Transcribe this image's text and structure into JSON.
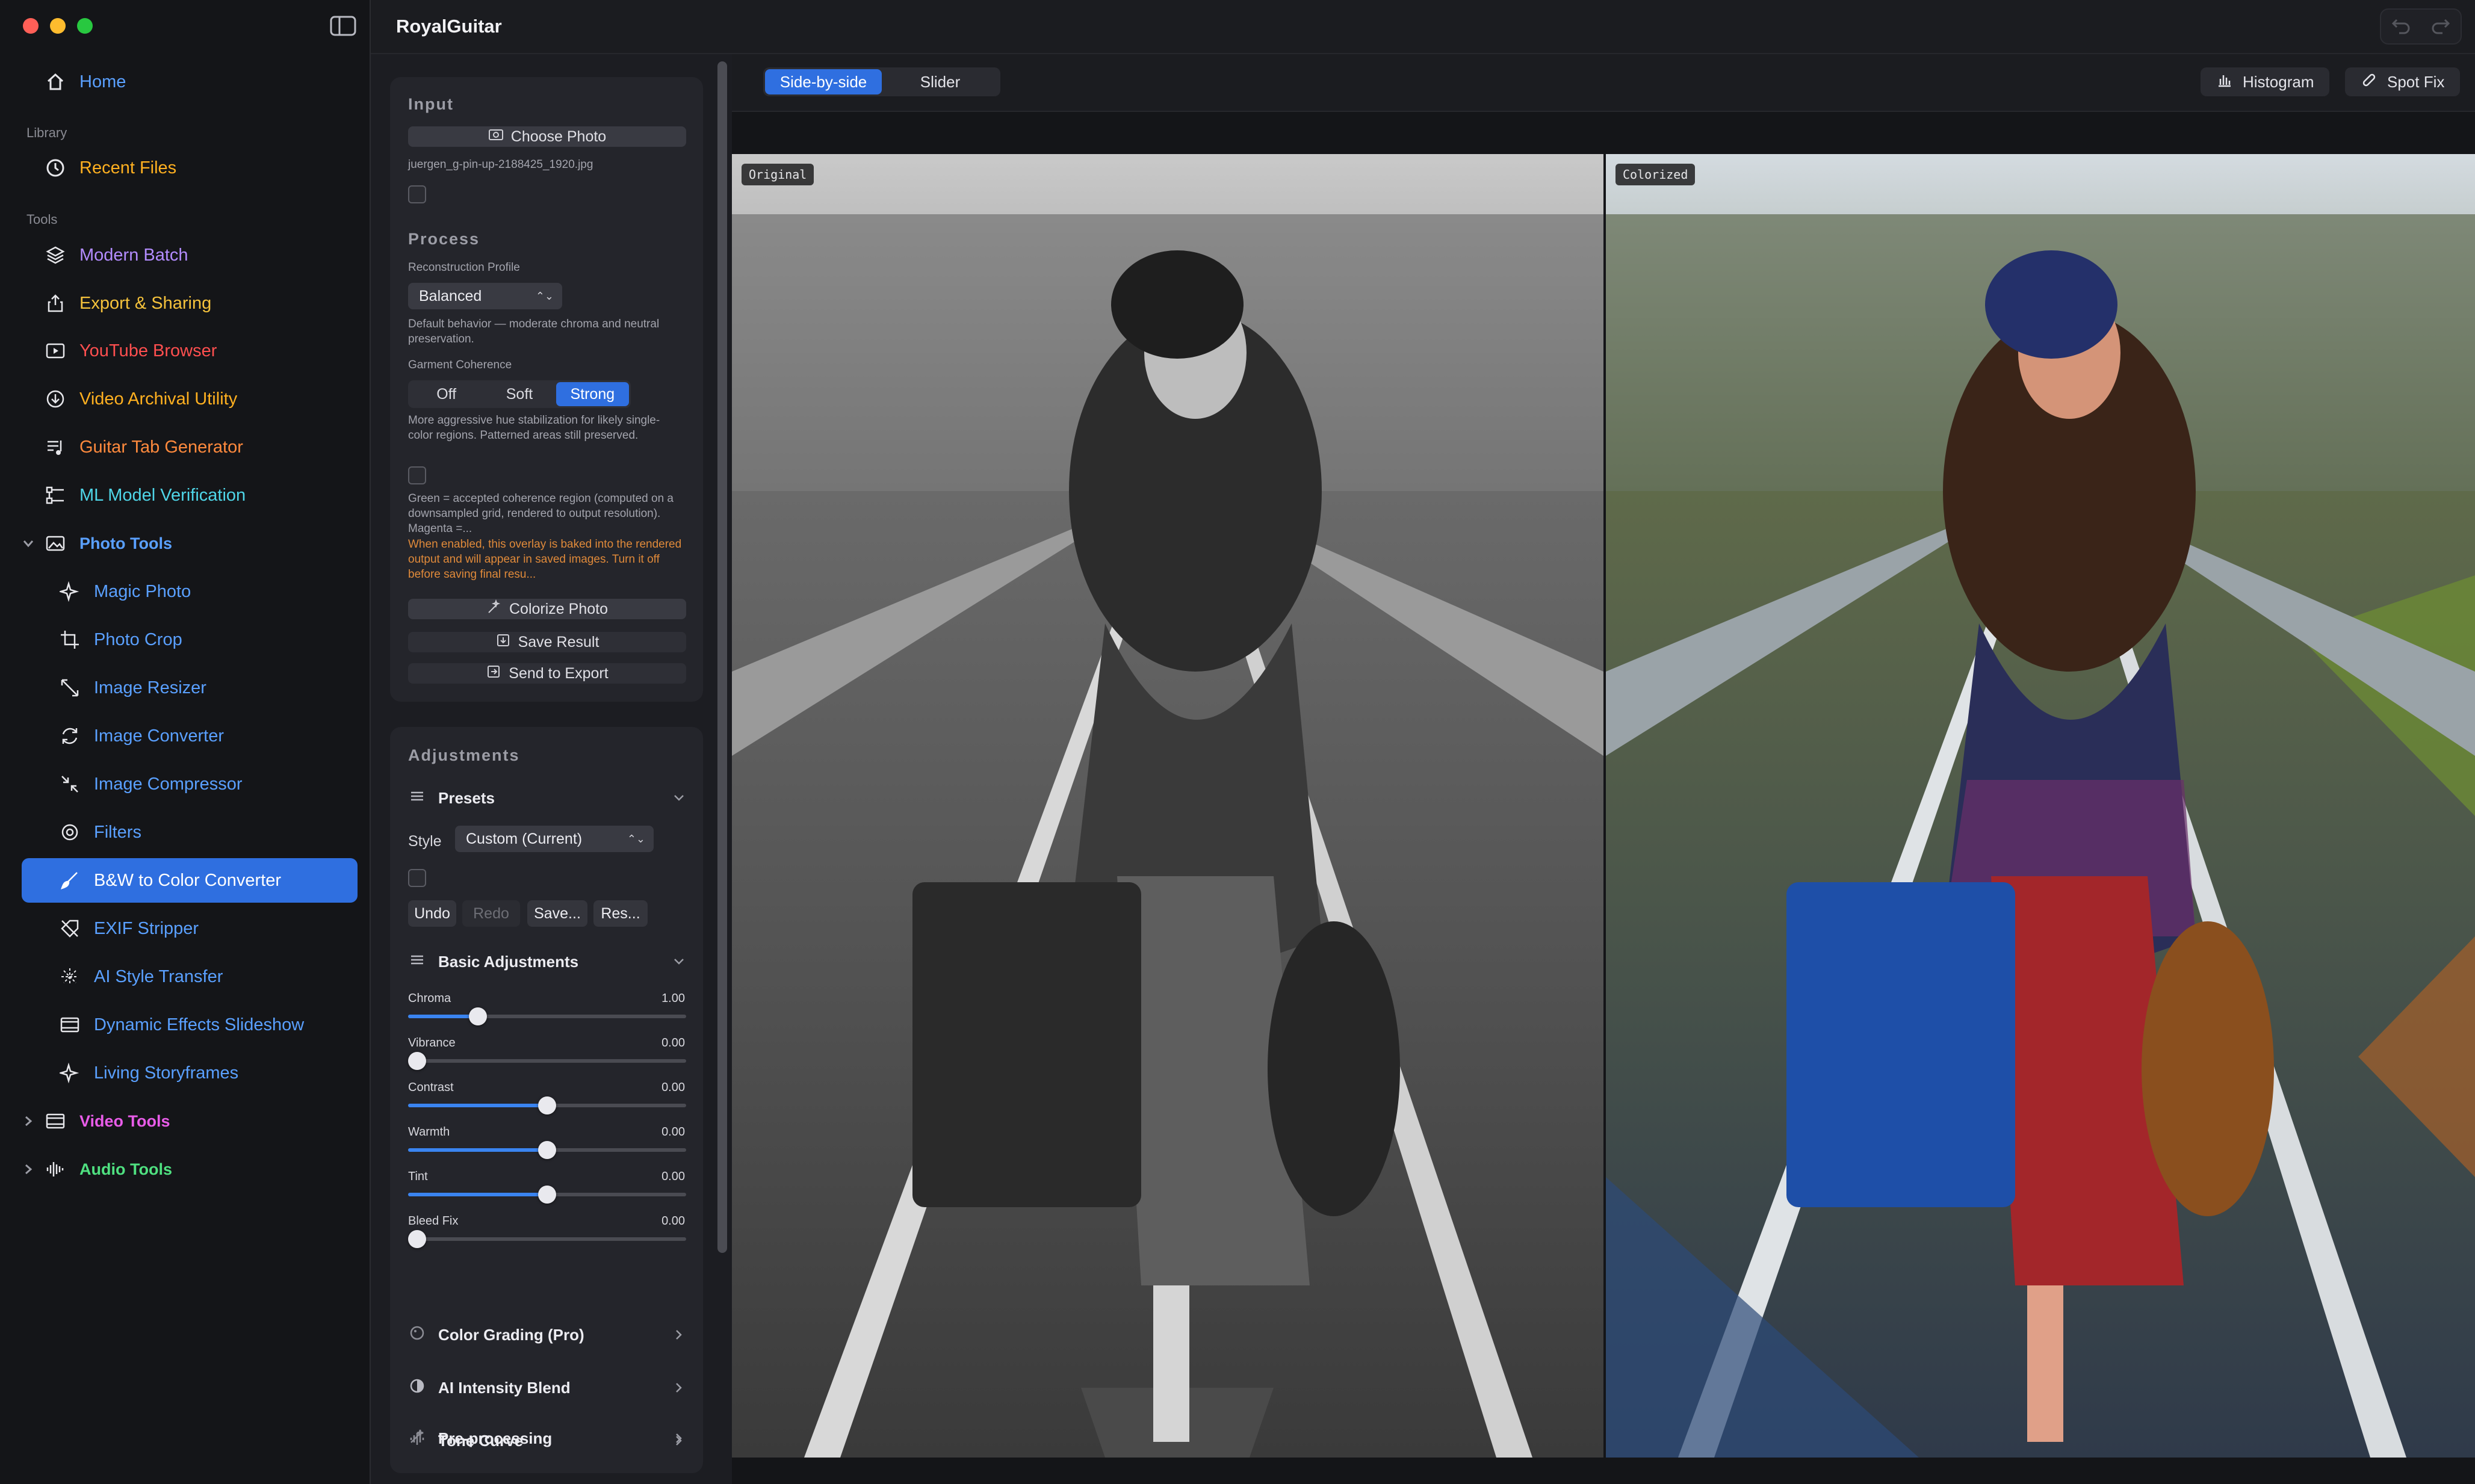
{
  "window": {
    "title": "RoyalGuitar"
  },
  "colors": {
    "accent": "#2f6fe0",
    "warning": "#e08a3a"
  },
  "sidebar": {
    "home": "Home",
    "library_label": "Library",
    "recent_files": "Recent Files",
    "tools_label": "Tools",
    "tools": [
      {
        "label": "Modern Batch",
        "icon": "layers-icon",
        "color": "#b38cff"
      },
      {
        "label": "Export & Sharing",
        "icon": "share-icon",
        "color": "#f5c23c"
      },
      {
        "label": "YouTube Browser",
        "icon": "play-icon",
        "color": "#ff4f4f"
      },
      {
        "label": "Video Archival Utility",
        "icon": "download-icon",
        "color": "#ffb020"
      },
      {
        "label": "Guitar Tab Generator",
        "icon": "music-icon",
        "color": "#ff8a3d"
      },
      {
        "label": "ML Model Verification",
        "icon": "flow-icon",
        "color": "#4fd6e8"
      }
    ],
    "photo_tools_label": "Photo Tools",
    "photo_tools": [
      {
        "label": "Magic Photo",
        "icon": "sparkle-icon"
      },
      {
        "label": "Photo Crop",
        "icon": "crop-icon"
      },
      {
        "label": "Image Resizer",
        "icon": "resize-icon"
      },
      {
        "label": "Image Converter",
        "icon": "convert-icon"
      },
      {
        "label": "Image Compressor",
        "icon": "compress-icon"
      },
      {
        "label": "Filters",
        "icon": "filter-icon"
      },
      {
        "label": "B&W to Color Converter",
        "icon": "brush-icon",
        "active": true
      },
      {
        "label": "EXIF Stripper",
        "icon": "tag-off-icon"
      },
      {
        "label": "AI Style Transfer",
        "icon": "sparkles-icon"
      },
      {
        "label": "Dynamic Effects Slideshow",
        "icon": "film-icon"
      },
      {
        "label": "Living Storyframes",
        "icon": "sparkle-icon"
      }
    ],
    "video_tools_label": "Video Tools",
    "audio_tools_label": "Audio Tools"
  },
  "input_card": {
    "title": "Input",
    "choose_photo": "Choose Photo",
    "filename": "juergen_g-pin-up-2188425_1920.jpg"
  },
  "process_card": {
    "title": "Process",
    "profile_label": "Reconstruction Profile",
    "profile_value": "Balanced",
    "profile_desc": "Default behavior — moderate chroma and neutral preservation.",
    "coherence_label": "Garment Coherence",
    "coherence_options": [
      "Off",
      "Soft",
      "Strong"
    ],
    "coherence_selected": "Strong",
    "coherence_desc": "More aggressive hue stabilization for likely single-color regions. Patterned areas still preserved.",
    "overlay_desc": "Green = accepted coherence region (computed on a downsampled grid, rendered to output resolution). Magenta =...",
    "overlay_warning": "When enabled, this overlay is baked into the rendered output and will appear in saved images. Turn it off before saving final resu...",
    "colorize": "Colorize Photo",
    "save_result": "Save Result",
    "send_export": "Send to Export"
  },
  "adjust_card": {
    "title": "Adjustments",
    "presets": "Presets",
    "style_label": "Style",
    "style_value": "Custom (Current)",
    "undo": "Undo",
    "redo": "Redo",
    "save": "Save...",
    "reset": "Res...",
    "basic": "Basic Adjustments",
    "sliders": [
      {
        "label": "Chroma",
        "value": "1.00",
        "fraction": 0.25,
        "fill_from_center": false
      },
      {
        "label": "Vibrance",
        "value": "0.00",
        "fraction": 0.0,
        "fill_from_center": false
      },
      {
        "label": "Contrast",
        "value": "0.00",
        "fraction": 0.5,
        "fill_from_center": false
      },
      {
        "label": "Warmth",
        "value": "0.00",
        "fraction": 0.5,
        "fill_from_center": false
      },
      {
        "label": "Tint",
        "value": "0.00",
        "fraction": 0.5,
        "fill_from_center": false
      },
      {
        "label": "Bleed Fix",
        "value": "0.00",
        "fraction": 0.0,
        "fill_from_center": false
      }
    ],
    "sections": [
      "Color Grading (Pro)",
      "AI Intensity Blend",
      "Tone Curve",
      "Pre-processing"
    ]
  },
  "view": {
    "modes": [
      "Side-by-side",
      "Slider"
    ],
    "mode_selected": "Side-by-side",
    "histogram": "Histogram",
    "spot_fix": "Spot Fix",
    "original_label": "Original",
    "colorized_label": "Colorized"
  }
}
